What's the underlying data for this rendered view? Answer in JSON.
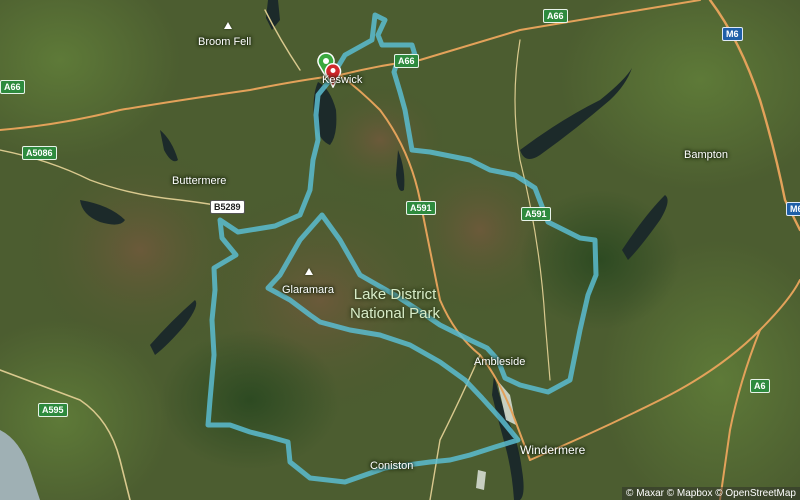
{
  "places": {
    "broom_fell": "Broom Fell",
    "keswick": "Keswick",
    "buttermere": "Buttermere",
    "glaramara": "Glaramara",
    "ambleside": "Ambleside",
    "coniston": "Coniston",
    "windermere": "Windermere",
    "bampton": "Bampton"
  },
  "park_label": {
    "line1": "Lake District",
    "line2": "National Park"
  },
  "roads": {
    "a66_top": "A66",
    "a66_keswick": "A66",
    "a66_left": "A66",
    "a5086": "A5086",
    "b5289": "B5289",
    "a591_mid": "A591",
    "a591_east": "A591",
    "m6": "M6",
    "m6_edge": "M6",
    "a6": "A6",
    "a595": "A595"
  },
  "attribution": "© Maxar © Mapbox © OpenStreetMap",
  "route": {
    "color": "#5bbcd0",
    "marker_colors": {
      "start": "#3aa83f",
      "end": "#d0282c"
    }
  },
  "colors": {
    "terrain": "#4a5a2e",
    "water": "#1c2a2a",
    "road_major": "#e3a25a",
    "road_minor": "#d9c98e"
  }
}
